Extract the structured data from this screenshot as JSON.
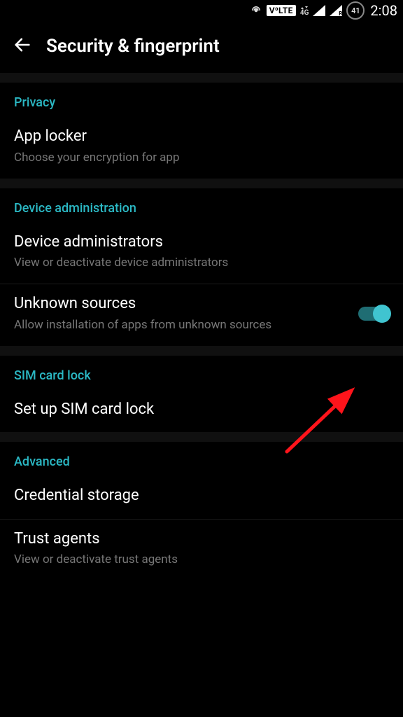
{
  "status": {
    "volte": "V⁰LTE",
    "net_label": "4G",
    "sim_label": "R",
    "battery": "41",
    "time": "2:08"
  },
  "header": {
    "title": "Security & fingerprint"
  },
  "sections": {
    "privacy": {
      "label": "Privacy",
      "app_locker": {
        "title": "App locker",
        "sub": "Choose your encryption for app"
      }
    },
    "device_admin": {
      "label": "Device administration",
      "admins": {
        "title": "Device administrators",
        "sub": "View or deactivate device administrators"
      },
      "unknown": {
        "title": "Unknown sources",
        "sub": "Allow installation of apps from unknown sources",
        "enabled": true
      }
    },
    "sim": {
      "label": "SIM card lock",
      "setup": {
        "title": "Set up SIM card lock"
      }
    },
    "advanced": {
      "label": "Advanced",
      "credential": {
        "title": "Credential storage"
      },
      "trust": {
        "title": "Trust agents",
        "sub": "View or deactivate trust agents"
      }
    }
  }
}
